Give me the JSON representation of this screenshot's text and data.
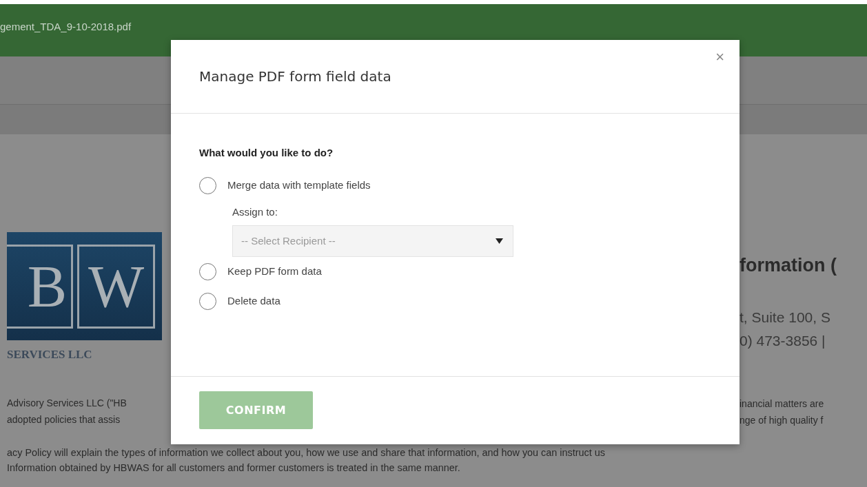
{
  "header": {
    "filename": "gement_TDA_9-10-2018.pdf"
  },
  "document": {
    "logo_letters": [
      "B",
      "W"
    ],
    "logo_caption": "SERVICES LLC",
    "heading": "formation (",
    "address_lines": [
      "t, Suite 100, S",
      "0) 473-3856 |"
    ],
    "paragraph_lines": [
      {
        "left": "Advisory Services LLC (\"HB",
        "right": "inancial matters are"
      },
      {
        "left": "adopted policies that assis",
        "right": "nge of high quality f"
      }
    ],
    "full_lines": [
      "acy Policy will explain the types of information we collect about you, how we use and share that information, and how you can instruct us",
      "Information obtained by HBWAS for all customers and former customers is treated in the same manner."
    ]
  },
  "modal": {
    "title": "Manage PDF form field data",
    "close": "×",
    "question": "What would you like to do?",
    "options": [
      {
        "kind": "radio",
        "label": "Merge data with template fields",
        "selected": false
      },
      {
        "kind": "assign",
        "label": "Assign to:",
        "placeholder": "-- Select Recipient --",
        "disabled": true
      },
      {
        "kind": "radio",
        "label": "Keep PDF form data",
        "selected": false
      },
      {
        "kind": "radio",
        "label": "Delete data",
        "selected": false
      }
    ],
    "confirm": {
      "label": "CONFIRM",
      "disabled": true
    }
  }
}
